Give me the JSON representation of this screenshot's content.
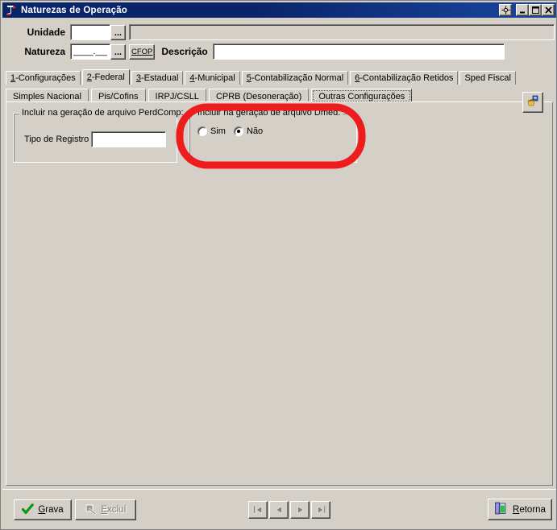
{
  "window": {
    "title": "Naturezas de Operação",
    "icon": "delphi-app-icon",
    "titlebar_buttons": [
      {
        "name": "move-resize-button",
        "glyph": "move-icon"
      },
      {
        "name": "minimize-button",
        "glyph": "minimize-icon"
      },
      {
        "name": "maximize-button",
        "glyph": "maximize-icon"
      },
      {
        "name": "close-button",
        "glyph": "close-icon"
      }
    ],
    "colors": {
      "titlebar_start": "#0a246a",
      "titlebar_end": "#1a47a0",
      "face": "#d4d0c8",
      "annotation": "#ee1c1c"
    }
  },
  "header": {
    "unidade": {
      "label": "Unidade",
      "value": "",
      "placeholder": "",
      "lookup_button": "...",
      "description_value": ""
    },
    "natureza": {
      "label": "Natureza",
      "value": "____.____",
      "mask": "____.____",
      "lookup_button": "...",
      "cfop_button": "CFOP",
      "cfop_accel": "C"
    },
    "descricao": {
      "label": "Descrição",
      "value": "",
      "placeholder": ""
    }
  },
  "tabs": {
    "active_index": 1,
    "items": [
      {
        "label": "1-Configurações",
        "accel": "1",
        "rest": "-Configurações"
      },
      {
        "label": "2-Federal",
        "accel": "2",
        "rest": "-Federal"
      },
      {
        "label": "3-Estadual",
        "accel": "3",
        "rest": "-Estadual"
      },
      {
        "label": "4-Municipal",
        "accel": "4",
        "rest": "-Municipal"
      },
      {
        "label": "5-Contabilização Normal",
        "accel": "5",
        "rest": "-Contabilização Normal"
      },
      {
        "label": "6-Contabilização Retidos",
        "accel": "6",
        "rest": "-Contabilização Retidos"
      },
      {
        "label": "Sped Fiscal",
        "accel": "",
        "rest": "Sped Fiscal"
      }
    ]
  },
  "subtabs": {
    "active_index": 4,
    "items": [
      {
        "label": "Simples Nacional"
      },
      {
        "label": "Pis/Cofins"
      },
      {
        "label": "IRPJ/CSLL"
      },
      {
        "label": "CPRB (Desoneração)"
      },
      {
        "label": "Outras Configurações"
      }
    ]
  },
  "panel": {
    "icon_button": {
      "name": "export-basket-icon",
      "tooltip": ""
    },
    "perdcomp_group": {
      "title": "Incluir na geração de arquivo PerdComp:",
      "tipo_registro": {
        "label": "Tipo de Registro",
        "value": "",
        "placeholder": ""
      }
    },
    "dmed_group": {
      "title": "Incluir na geração de arquivo Dmed:",
      "selected": "Não",
      "options": [
        {
          "label": "Sim",
          "checked": false
        },
        {
          "label": "Não",
          "checked": true
        }
      ]
    }
  },
  "footer": {
    "grava": {
      "label": "Grava",
      "accel": "G",
      "rest": "rava",
      "icon": "green-check-icon",
      "disabled": false
    },
    "exclui": {
      "label": "Excluí",
      "accel": "E",
      "rest": "xcluí",
      "icon": "delete-icon",
      "disabled": true
    },
    "retorna": {
      "label": "Retorna",
      "accel": "R",
      "rest": "etorna",
      "icon": "exit-door-icon",
      "disabled": false
    },
    "nav": [
      {
        "name": "nav-first-button",
        "glyph": "|◀",
        "disabled": true
      },
      {
        "name": "nav-prev-button",
        "glyph": "◀",
        "disabled": true
      },
      {
        "name": "nav-next-button",
        "glyph": "▶",
        "disabled": true
      },
      {
        "name": "nav-last-button",
        "glyph": "▶|",
        "disabled": true
      }
    ]
  }
}
